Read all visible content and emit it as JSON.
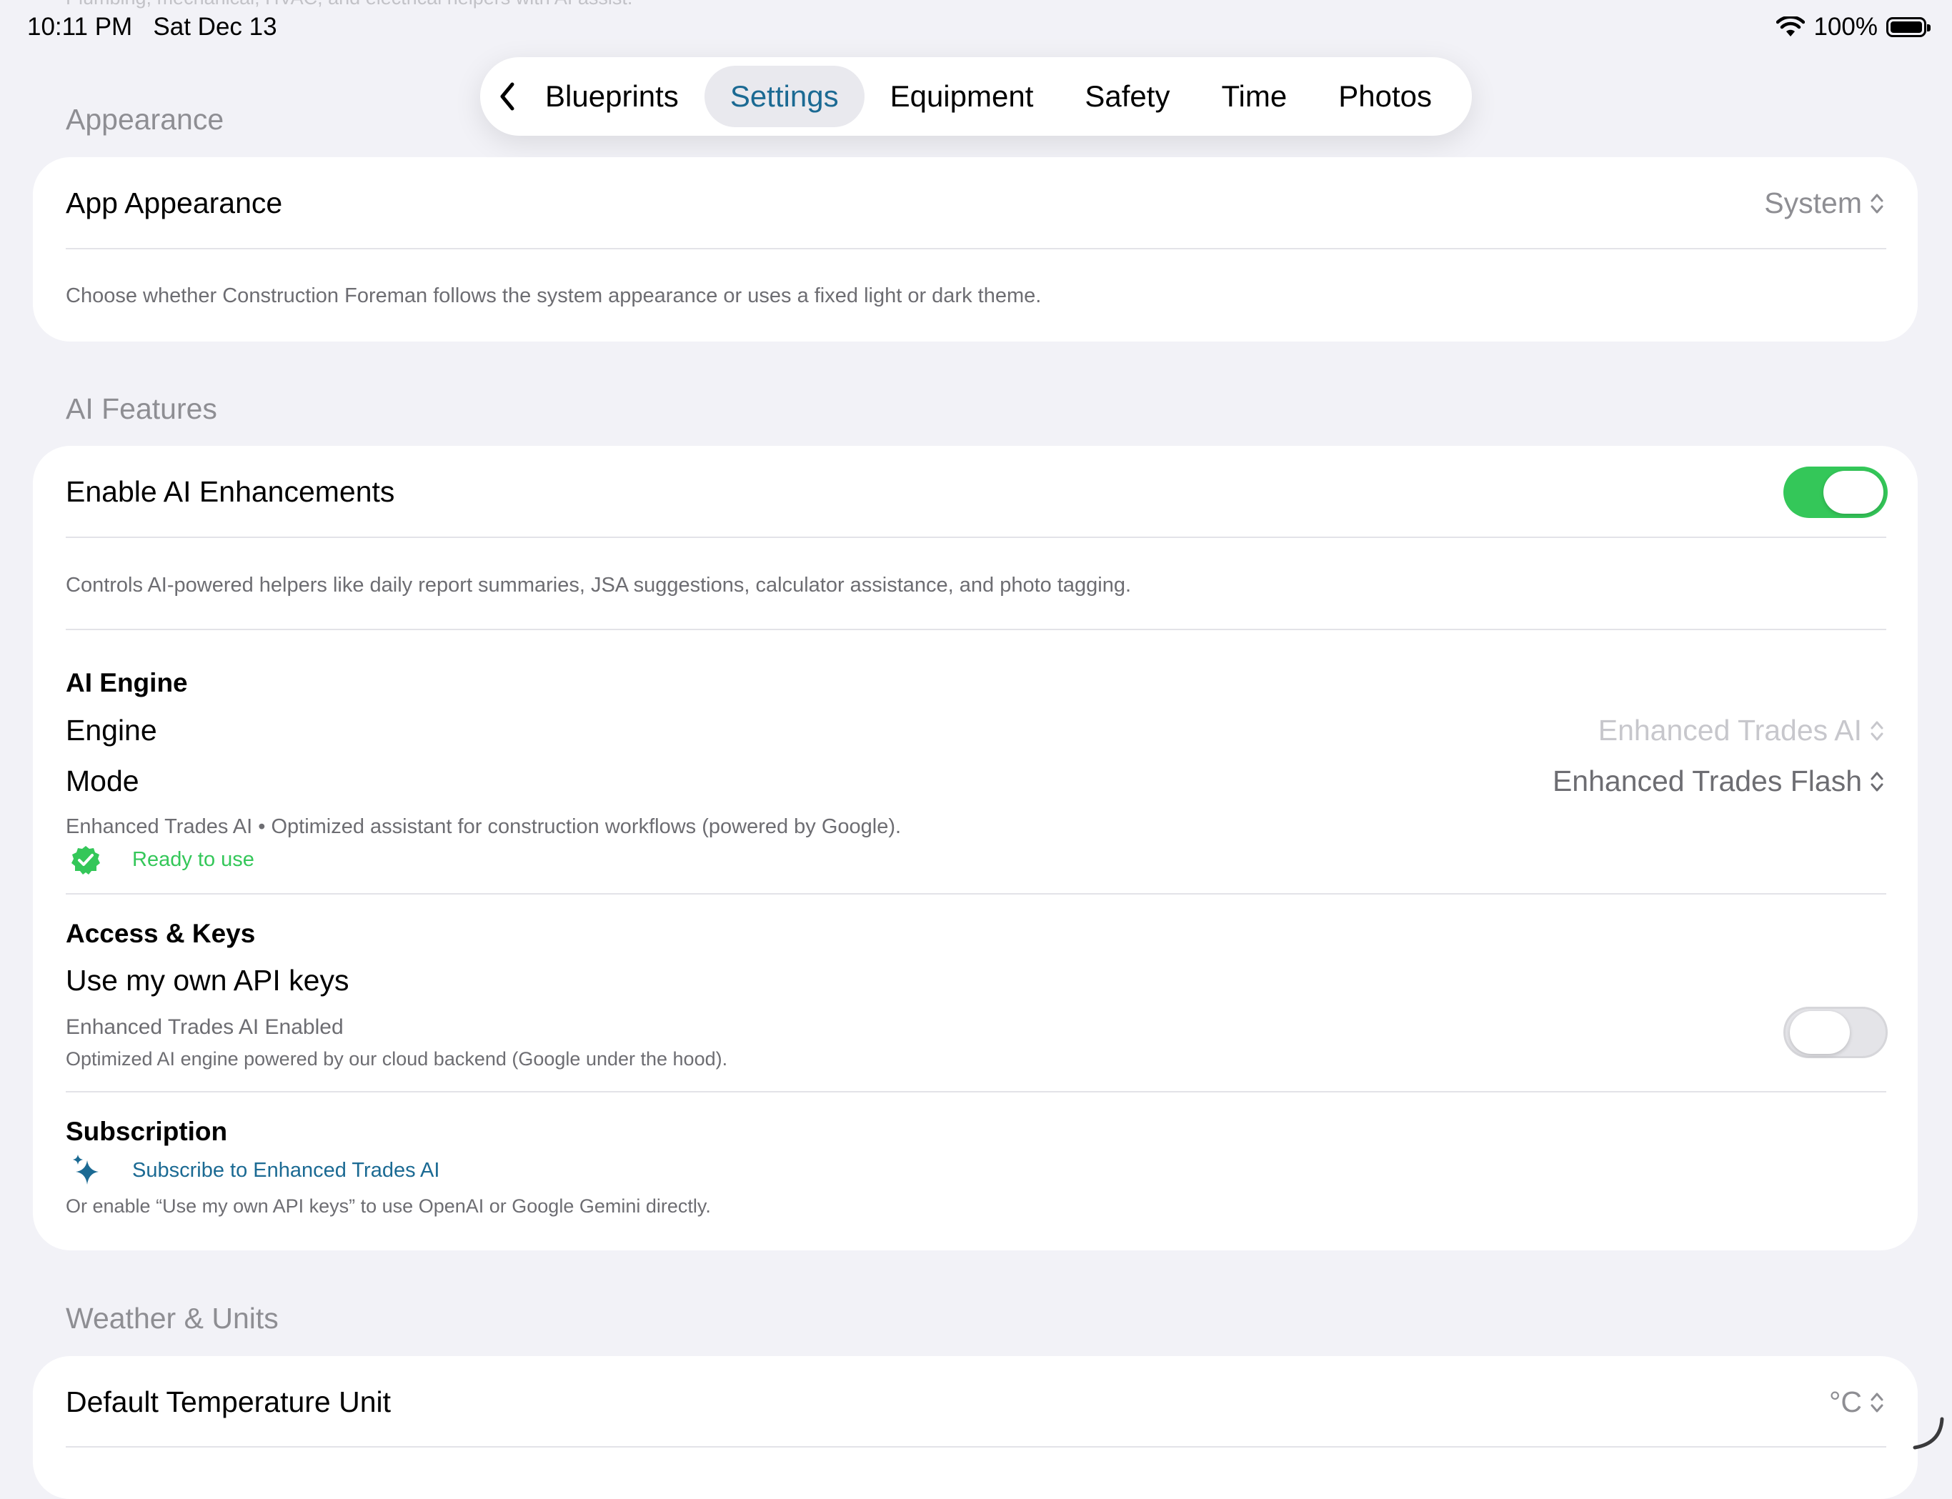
{
  "peek_text": "Plumbing, mechanical, HVAC, and electrical helpers with AI assist.",
  "status": {
    "time": "10:11 PM",
    "date": "Sat Dec 13",
    "battery": "100%",
    "battery_level": 1.0
  },
  "tabs": [
    {
      "label": "Blueprints",
      "active": false
    },
    {
      "label": "Settings",
      "active": true
    },
    {
      "label": "Equipment",
      "active": false
    },
    {
      "label": "Safety",
      "active": false
    },
    {
      "label": "Time",
      "active": false
    },
    {
      "label": "Photos",
      "active": false
    }
  ],
  "appearance": {
    "header": "Appearance",
    "label": "App Appearance",
    "value": "System",
    "footer": "Choose whether Construction Foreman follows the system appearance or uses a fixed light or dark theme."
  },
  "ai": {
    "header": "AI Features",
    "enable_label": "Enable AI Enhancements",
    "enable_on": true,
    "enable_footer": "Controls AI-powered helpers like daily report summaries, JSA suggestions, calculator assistance, and photo tagging.",
    "engine_section": "AI Engine",
    "engine_label": "Engine",
    "engine_value": "Enhanced Trades AI",
    "mode_label": "Mode",
    "mode_value": "Enhanced Trades Flash",
    "engine_desc": "Enhanced Trades AI • Optimized assistant for construction workflows (powered by Google).",
    "ready_text": "Ready to use",
    "access_section": "Access & Keys",
    "own_keys_label": "Use my own API keys",
    "own_keys_on": false,
    "enabled_line": "Enhanced Trades AI Enabled",
    "enabled_desc": "Optimized AI engine powered by our cloud backend (Google under the hood).",
    "subscription_section": "Subscription",
    "subscribe_link": "Subscribe to Enhanced Trades AI",
    "subscribe_note": "Or enable “Use my own API keys” to use OpenAI or Google Gemini directly."
  },
  "weather": {
    "header": "Weather & Units",
    "temp_label": "Default Temperature Unit",
    "temp_value": "°C"
  },
  "colors": {
    "accent": "#1b6a93",
    "toggle_on": "#34c759",
    "ready": "#34c759",
    "background": "#f2f2f7"
  },
  "icons": {
    "back": "chevron-left-icon",
    "ready": "checkmark-seal-icon",
    "subscribe": "sparkles-icon",
    "picker": "chevron-up-down-icon"
  }
}
